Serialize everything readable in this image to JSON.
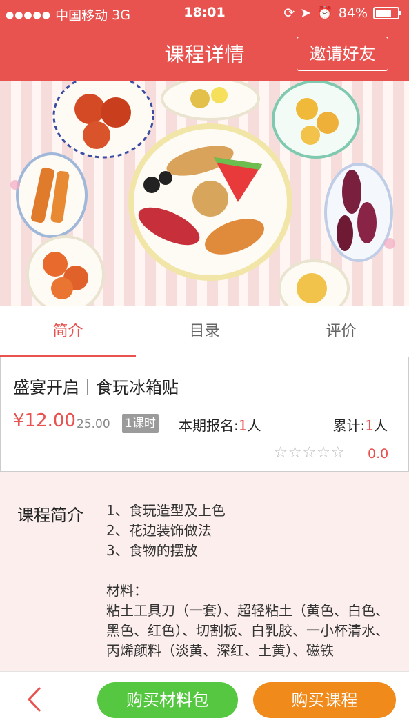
{
  "status_bar": {
    "carrier": "中国移动",
    "network": "3G",
    "time": "18:01",
    "battery": "84%",
    "battery_level": 0.84
  },
  "nav": {
    "title": "课程详情",
    "invite_label": "邀请好友"
  },
  "carousel": {
    "page_count": 4,
    "active_index": 0
  },
  "tabs": [
    {
      "label": "简介",
      "active": true
    },
    {
      "label": "目录",
      "active": false
    },
    {
      "label": "评价",
      "active": false
    }
  ],
  "course": {
    "title": "盛宴开启｜食玩冰箱贴",
    "price": "¥12.00",
    "original_price": "25.00",
    "lesson_badge": "1课时",
    "enroll_label": "本期报名:",
    "enroll_count": "1",
    "enroll_unit": "人",
    "total_label": "累计:",
    "total_count": "1",
    "total_unit": "人",
    "stars": "☆☆☆☆☆",
    "rating": "0.0"
  },
  "intro": {
    "label": "课程简介",
    "lines": [
      "1、食玩造型及上色",
      "2、花边装饰做法",
      "3、食物的摆放",
      "",
      "材料：",
      "粘土工具刀（一套）、超轻粘土（黄色、白色、黑色、红色）、切割板、白乳胶、一小杯清水、丙烯颜料（淡黄、深红、土黄）、磁铁"
    ]
  },
  "bottom_bar": {
    "buy_kit_label": "购买材料包",
    "buy_course_label": "购买课程"
  },
  "colors": {
    "accent": "#e8524f",
    "kit_button": "#55c740",
    "course_button": "#f08a1b"
  }
}
